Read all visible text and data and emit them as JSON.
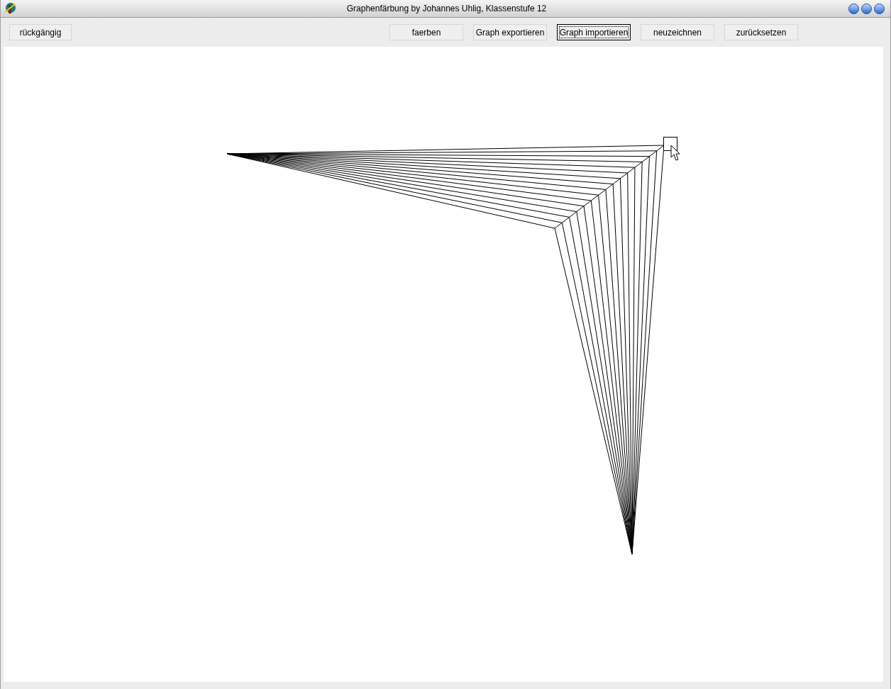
{
  "window": {
    "title": "Graphenfärbung by Johannes Uhlig, Klassenstufe 12"
  },
  "toolbar": {
    "left_buttons": [
      {
        "label": "rückgängig",
        "focused": false
      }
    ],
    "right_buttons": [
      {
        "label": "faerben",
        "focused": false
      },
      {
        "label": "Graph exportieren",
        "focused": false
      },
      {
        "label": "Graph importieren",
        "focused": true
      },
      {
        "label": "neuzeichnen",
        "focused": false
      },
      {
        "label": "zurücksetzen",
        "focused": false
      }
    ]
  }
}
